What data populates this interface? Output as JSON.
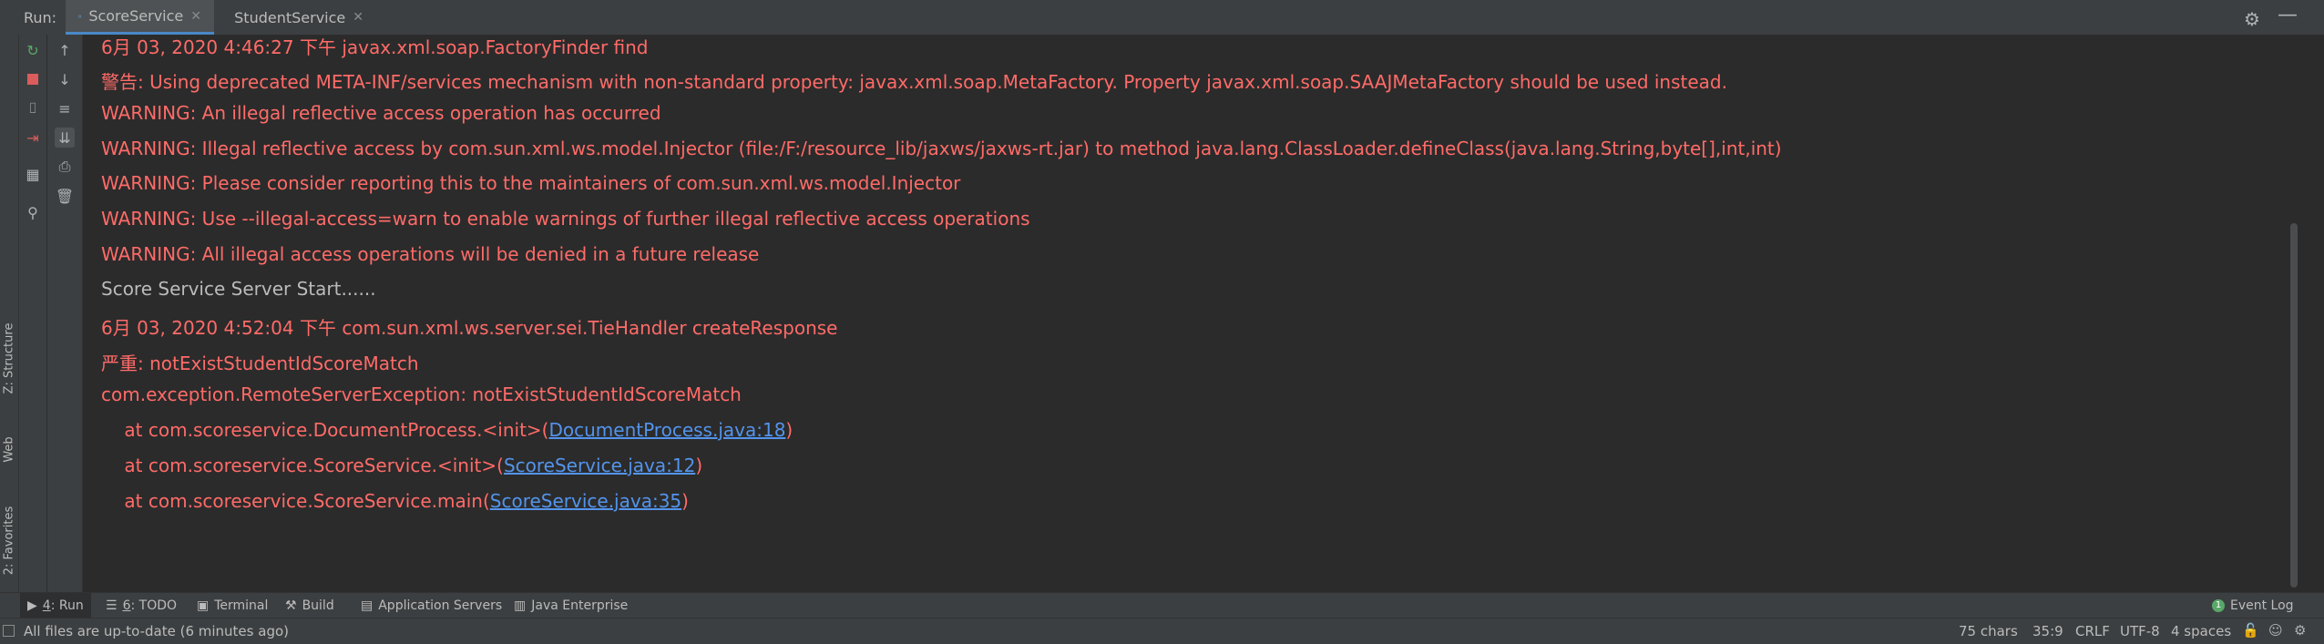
{
  "header": {
    "run_label": "Run:",
    "tabs": [
      {
        "label": "ScoreService",
        "active": true
      },
      {
        "label": "StudentService",
        "active": false
      }
    ]
  },
  "sidebar": {
    "structure_label": "Z: Structure",
    "web_label": "Web",
    "favorites_label": "2: Favorites"
  },
  "console": {
    "lines": [
      {
        "text": "6月 03, 2020 4:46:27 下午 javax.xml.soap.FactoryFinder find",
        "style": "err"
      },
      {
        "text": "警告: Using deprecated META-INF/services mechanism with non-standard property: javax.xml.soap.MetaFactory. Property javax.xml.soap.SAAJMetaFactory should be used instead.",
        "style": "err"
      },
      {
        "text": "WARNING: An illegal reflective access operation has occurred",
        "style": "err"
      },
      {
        "text": "WARNING: Illegal reflective access by com.sun.xml.ws.model.Injector (file:/F:/resource_lib/jaxws/jaxws-rt.jar) to method java.lang.ClassLoader.defineClass(java.lang.String,byte[],int,int)",
        "style": "err"
      },
      {
        "text": "WARNING: Please consider reporting this to the maintainers of com.sun.xml.ws.model.Injector",
        "style": "err"
      },
      {
        "text": "WARNING: Use --illegal-access=warn to enable warnings of further illegal reflective access operations",
        "style": "err"
      },
      {
        "text": "WARNING: All illegal access operations will be denied in a future release",
        "style": "err"
      },
      {
        "text": "Score Service Server Start......",
        "style": "norm"
      },
      {
        "text": "6月 03, 2020 4:52:04 下午 com.sun.xml.ws.server.sei.TieHandler createResponse",
        "style": "err"
      },
      {
        "text": "严重: notExistStudentIdScoreMatch",
        "style": "err"
      },
      {
        "text": "com.exception.RemoteServerException: notExistStudentIdScoreMatch",
        "style": "err"
      }
    ],
    "stack": [
      {
        "prefix": "    at com.scoreservice.DocumentProcess.<init>(",
        "link": "DocumentProcess.java:18",
        "suffix": ")"
      },
      {
        "prefix": "    at com.scoreservice.ScoreService.<init>(",
        "link": "ScoreService.java:12",
        "suffix": ")"
      },
      {
        "prefix": "    at com.scoreservice.ScoreService.main(",
        "link": "ScoreService.java:35",
        "suffix": ")"
      }
    ]
  },
  "tooltabs": {
    "run": {
      "num": "4",
      "label": ": Run"
    },
    "todo": {
      "num": "6",
      "label": ": TODO"
    },
    "terminal": "Terminal",
    "build": "Build",
    "app_servers": "Application Servers",
    "java_ee": "Java Enterprise",
    "event_log": "Event Log"
  },
  "status": {
    "message": "All files are up-to-date (6 minutes ago)",
    "chars": "75 chars",
    "position": "35:9",
    "line_sep": "CRLF",
    "encoding": "UTF-8",
    "indent": "4 spaces"
  },
  "colors": {
    "error_text": "#ff6b68",
    "normal_text": "#bbbbbb",
    "link": "#5394ec",
    "background": "#2b2b2b",
    "panel": "#3c3f41"
  }
}
